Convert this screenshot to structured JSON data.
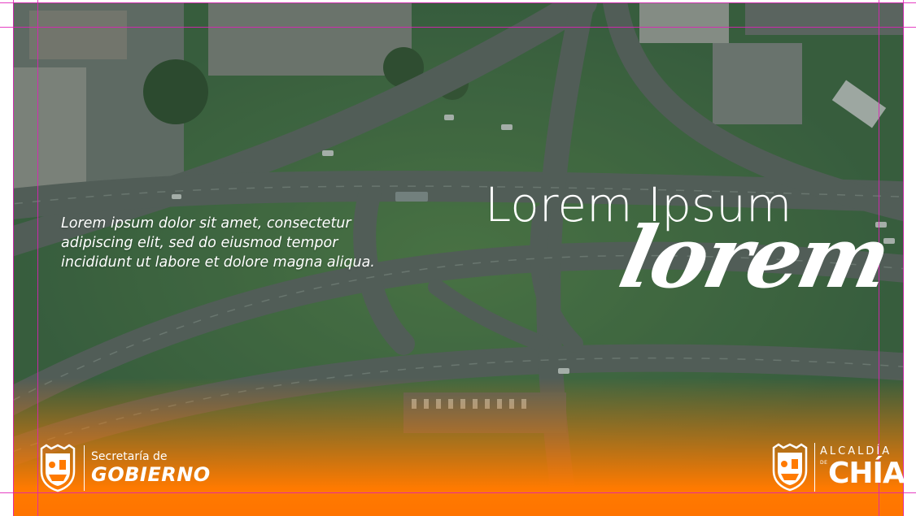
{
  "body_text": "Lorem ipsum dolor sit amet, consectetur adipiscing elit, sed do eiusmod tempor incididunt ut labore et dolore magna aliqua.",
  "headline": "Lorem Ipsum",
  "script_word": "lorem",
  "footer": {
    "left": {
      "line1": "Secretaría de",
      "line2": "GOBIERNO"
    },
    "right": {
      "line1": "ALCALDÍA",
      "de": "DE",
      "line2": "CHÍA"
    }
  },
  "colors": {
    "accent_orange": "#ff7a00",
    "guide_magenta": "#e020b8",
    "text": "#ffffff"
  },
  "icons": [
    "coat-of-arms-icon",
    "coat-of-arms-icon"
  ]
}
